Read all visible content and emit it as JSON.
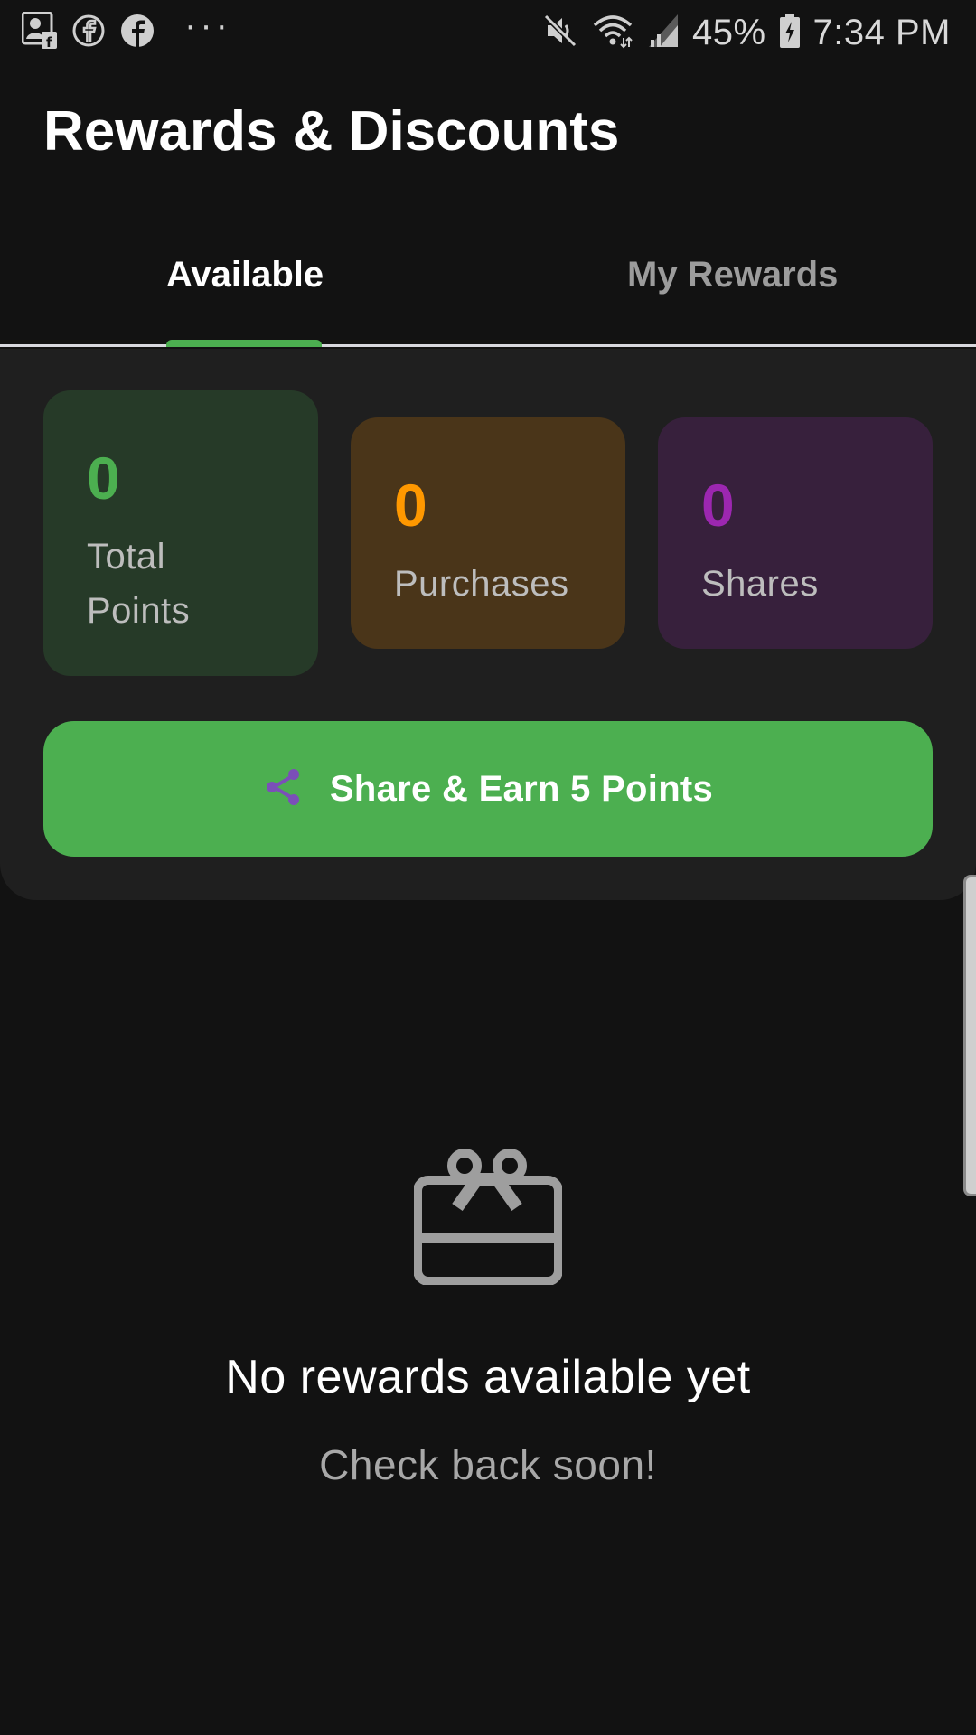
{
  "status_bar": {
    "battery": "45%",
    "time": "7:34 PM",
    "icons_left": [
      "contact-card-icon",
      "facebook-outline-icon",
      "facebook-icon",
      "more-dots-icon"
    ],
    "icons_right": [
      "mute-icon",
      "wifi-icon",
      "signal-icon",
      "battery-charging-icon"
    ],
    "dots": "···"
  },
  "header": {
    "title": "Rewards & Discounts"
  },
  "tabs": [
    {
      "label": "Available",
      "selected": true
    },
    {
      "label": "My Rewards",
      "selected": false
    }
  ],
  "stats": {
    "total_points": {
      "value": "0",
      "label": "Total Points"
    },
    "purchases": {
      "value": "0",
      "label": "Purchases"
    },
    "shares": {
      "value": "0",
      "label": "Shares"
    }
  },
  "share_button": {
    "label": "Share & Earn 5 Points",
    "icon": "share-icon"
  },
  "empty_state": {
    "icon": "gift-card-icon",
    "title": "No rewards available yet",
    "subtitle": "Check back soon!"
  },
  "colors": {
    "accent_green": "#4caf50",
    "orange": "#ff9800",
    "purple": "#9c27b0",
    "background": "#121212",
    "panel": "#1f1f1f"
  }
}
